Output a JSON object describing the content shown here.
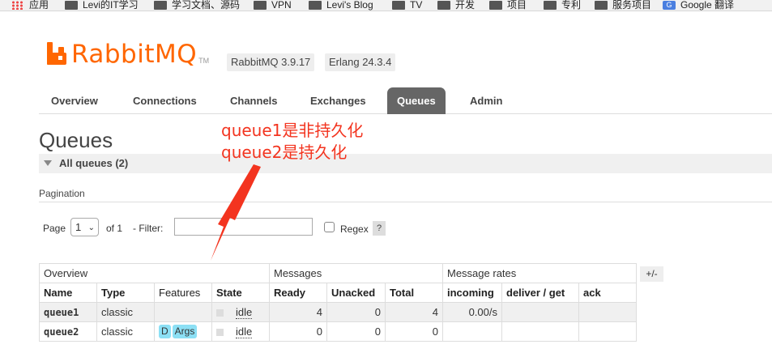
{
  "bookmarks": [
    {
      "icon": "apps-icon",
      "label": "应用"
    },
    {
      "icon": "folder-icon",
      "label": "Levi的IT学习"
    },
    {
      "icon": "folder-icon",
      "label": "学习文档、源码"
    },
    {
      "icon": "folder-icon",
      "label": "VPN"
    },
    {
      "icon": "folder-icon",
      "label": "Levi's Blog"
    },
    {
      "icon": "folder-icon",
      "label": "TV"
    },
    {
      "icon": "folder-icon",
      "label": "开发"
    },
    {
      "icon": "folder-icon",
      "label": "项目"
    },
    {
      "icon": "folder-icon",
      "label": "专利"
    },
    {
      "icon": "folder-icon",
      "label": "服务项目"
    },
    {
      "icon": "google-translate-icon",
      "label": "Google 翻译"
    }
  ],
  "header": {
    "logo_text": "RabbitMQ",
    "logo_tm": "TM",
    "version": "RabbitMQ 3.9.17",
    "erlang": "Erlang 24.3.4"
  },
  "tabs": [
    "Overview",
    "Connections",
    "Channels",
    "Exchanges",
    "Queues",
    "Admin"
  ],
  "active_tab": "Queues",
  "page_title": "Queues",
  "section_label": "All queues (2)",
  "pagination": {
    "title": "Pagination",
    "page_label": "Page",
    "page_value": "1",
    "of_label": "of 1",
    "filter_label": "- Filter:",
    "filter_value": "",
    "regex_label": "Regex",
    "regex_checked": false,
    "help": "?"
  },
  "table": {
    "groups": [
      "Overview",
      "Messages",
      "Message rates"
    ],
    "columns": [
      "Name",
      "Type",
      "Features",
      "State",
      "Ready",
      "Unacked",
      "Total",
      "incoming",
      "deliver / get",
      "ack"
    ],
    "rows": [
      {
        "name": "queue1",
        "type": "classic",
        "features": [],
        "state": "idle",
        "ready": "4",
        "unacked": "0",
        "total": "4",
        "incoming": "0.00/s",
        "deliver": "",
        "ack": ""
      },
      {
        "name": "queue2",
        "type": "classic",
        "features": [
          "D",
          "Args"
        ],
        "state": "idle",
        "ready": "0",
        "unacked": "0",
        "total": "0",
        "incoming": "",
        "deliver": "",
        "ack": ""
      }
    ],
    "toggle_columns": "+/-"
  },
  "annotation": {
    "line1": "queue1是非持久化",
    "line2": "queue2是持久化",
    "color": "#f3341f"
  }
}
